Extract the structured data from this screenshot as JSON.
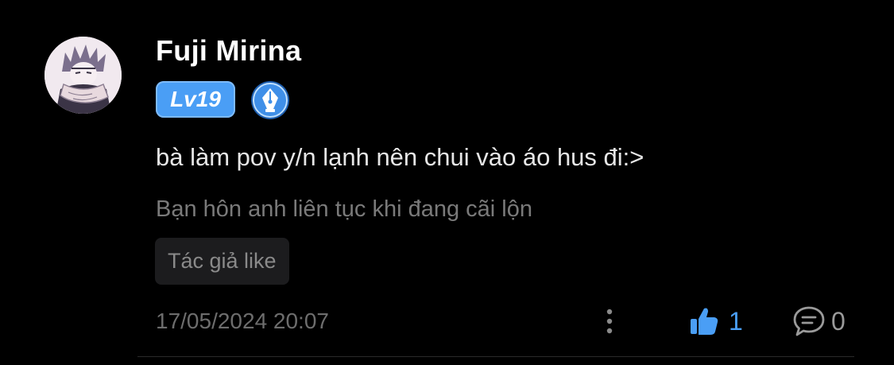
{
  "comment": {
    "user": {
      "name": "Fuji Mirina",
      "level": "Lv19"
    },
    "text": "bà làm pov y/n lạnh nên chui vào áo hus đi:>",
    "chapter_ref": "Bạn hôn anh liên tục khi đang cãi lộn",
    "author_like_tag": "Tác giả like",
    "timestamp": "17/05/2024 20:07",
    "likes": "1",
    "replies": "0"
  },
  "icons": {
    "avatar": "avatar-illustration",
    "badge": "fountain-pen-icon",
    "more": "vertical-dots-icon",
    "like": "thumbs-up-icon",
    "reply": "speech-bubble-icon"
  },
  "colors": {
    "background": "#000000",
    "accent": "#4a9ef5",
    "username": "#ffffff",
    "comment_text": "#e6e6e6",
    "muted_text": "#7a7a7a",
    "tag_background": "#1c1c1e"
  }
}
